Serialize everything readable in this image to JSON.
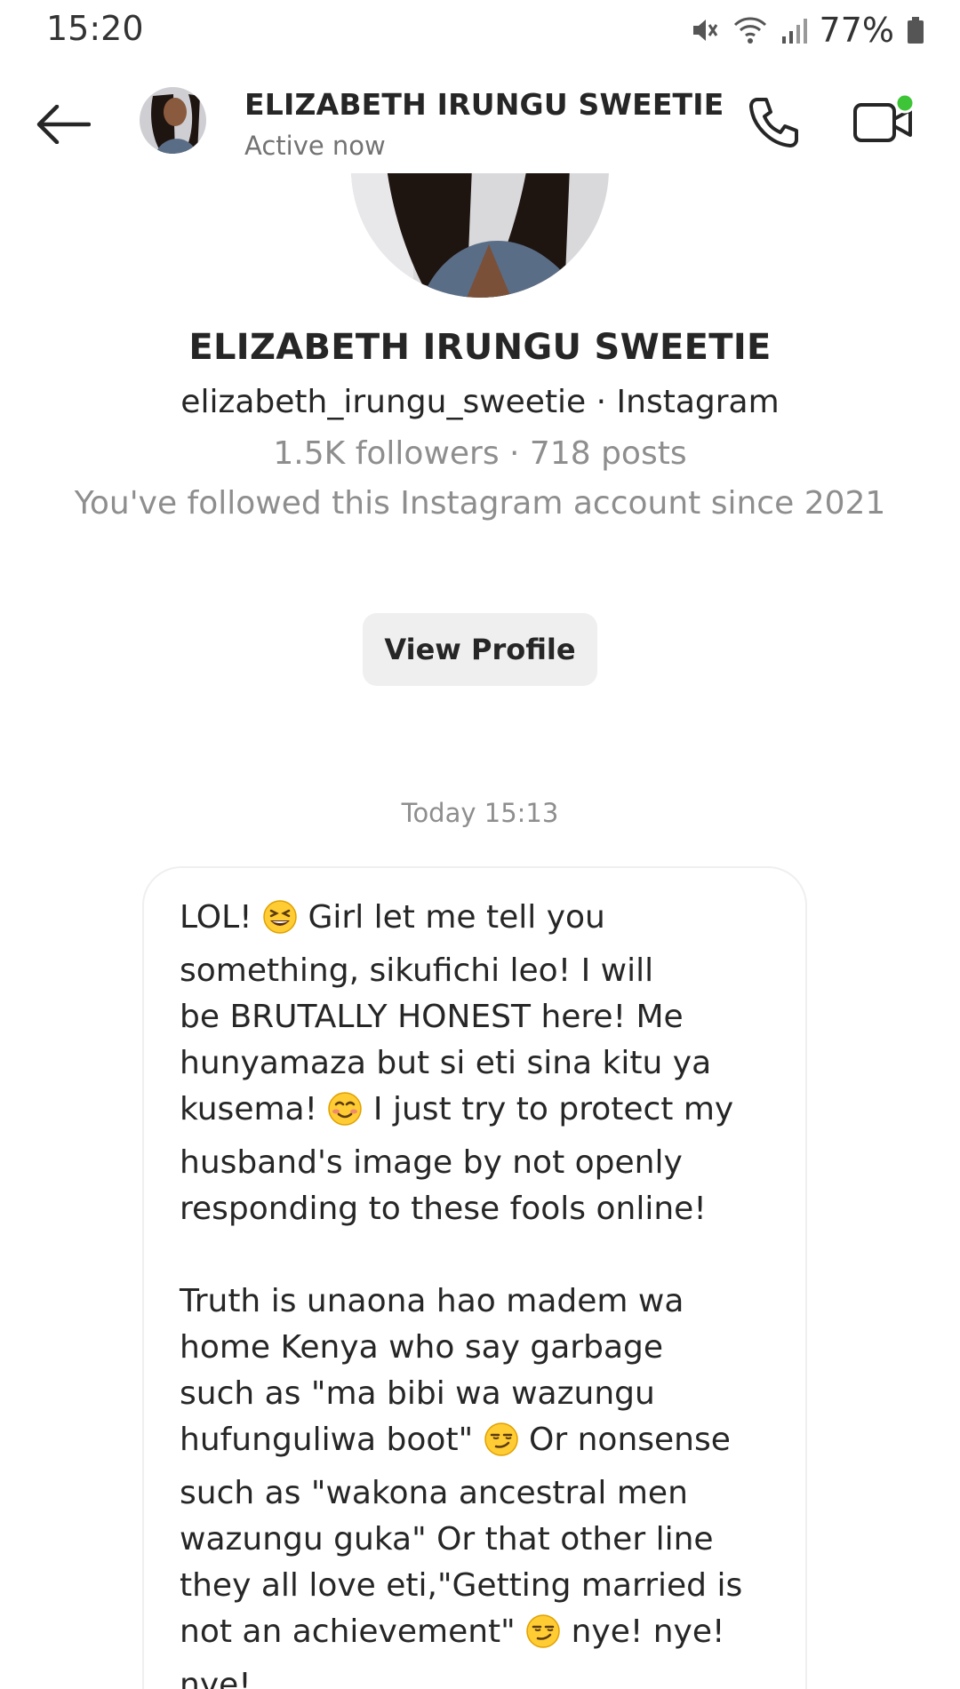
{
  "status_bar": {
    "time": "15:20",
    "battery": "77%"
  },
  "header": {
    "name": "ELIZABETH IRUNGU SWEETIE",
    "status": "Active now",
    "online_dot_color": "#3ec437"
  },
  "profile": {
    "name": "ELIZABETH IRUNGU SWEETIE",
    "handle": "elizabeth_irungu_sweetie · Instagram",
    "stats": "1.5K followers · 718 posts",
    "since": "You've followed this Instagram account since 2021",
    "view_profile_label": "View Profile"
  },
  "thread": {
    "timestamp": "Today 15:13",
    "message": {
      "seg1": "LOL! ",
      "emoji1": "grinning-squinting-face",
      "seg2": " Girl let me tell you\nsomething, sikufichi leo! I will\nbe BRUTALLY HONEST here! Me\nhunyamaza but si eti sina kitu ya\nkusema! ",
      "emoji2": "smiling-face",
      "seg3": " I just try to protect my\nhusband's image by not openly\nresponding to these fools online!\n\nTruth is unaona hao madem wa\nhome Kenya who say garbage\nsuch as \"ma bibi wa wazungu\nhufunguliwa boot\" ",
      "emoji3": "smirking-face",
      "seg4": " Or nonsense\nsuch as \"wakona ancestral men\nwazungu guka\" Or that other line\nthey all love eti,\"Getting married is\nnot an achievement\" ",
      "emoji4": "smirking-face",
      "seg5": " nye! nye!\nnye!"
    }
  }
}
